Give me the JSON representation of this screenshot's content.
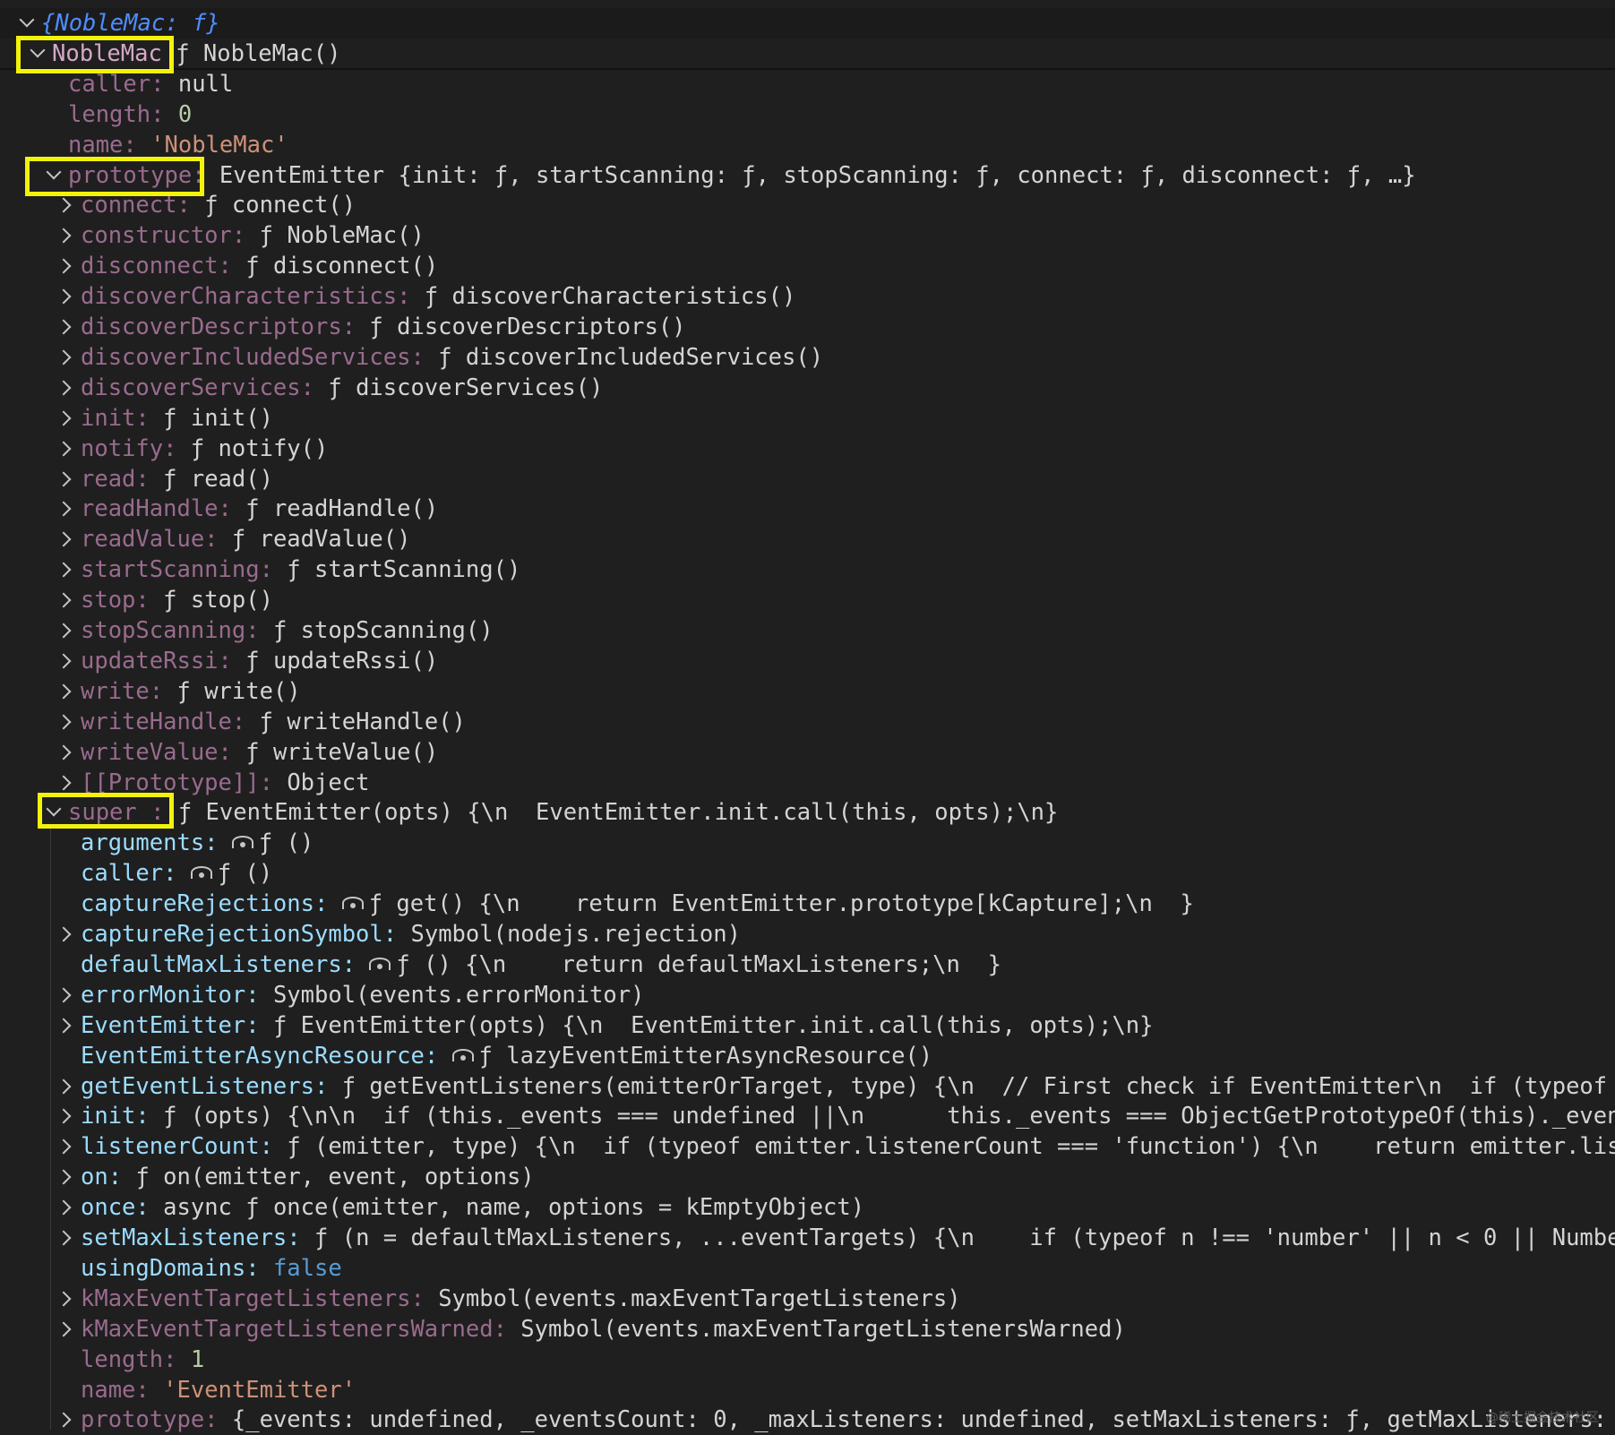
{
  "rows": [
    {
      "indent": 0,
      "twisty": "expanded",
      "key": "{NobleMac:",
      "keyClass": "root",
      "value": " f}",
      "valueClass": "root-f",
      "noColon": true
    },
    {
      "indent": 1,
      "twisty": "expanded",
      "key": "NobleMac",
      "keyClass": "plain",
      "value": "ƒ NobleMac()",
      "valueClass": "fn"
    },
    {
      "indent": 2,
      "twisty": "none",
      "key": "caller",
      "keyClass": "dim",
      "value": "null",
      "valueClass": "kw-plain"
    },
    {
      "indent": 2,
      "twisty": "none",
      "key": "length",
      "keyClass": "dim",
      "value": "0",
      "valueClass": "num"
    },
    {
      "indent": 2,
      "twisty": "none",
      "key": "name",
      "keyClass": "dim",
      "value": "'NobleMac'",
      "valueClass": "str"
    },
    {
      "indent": 2,
      "twisty": "expanded",
      "key": "prototype",
      "keyClass": "dim",
      "value": "EventEmitter {init: ƒ, startScanning: ƒ, stopScanning: ƒ, connect: ƒ, disconnect: ƒ, …}",
      "valueClass": "fn"
    },
    {
      "indent": 3,
      "twisty": "collapsed",
      "key": "connect",
      "keyClass": "dim",
      "value": "ƒ connect()",
      "valueClass": "fn"
    },
    {
      "indent": 3,
      "twisty": "collapsed",
      "key": "constructor",
      "keyClass": "dim",
      "value": "ƒ NobleMac()",
      "valueClass": "fn"
    },
    {
      "indent": 3,
      "twisty": "collapsed",
      "key": "disconnect",
      "keyClass": "dim",
      "value": "ƒ disconnect()",
      "valueClass": "fn"
    },
    {
      "indent": 3,
      "twisty": "collapsed",
      "key": "discoverCharacteristics",
      "keyClass": "dim",
      "value": "ƒ discoverCharacteristics()",
      "valueClass": "fn"
    },
    {
      "indent": 3,
      "twisty": "collapsed",
      "key": "discoverDescriptors",
      "keyClass": "dim",
      "value": "ƒ discoverDescriptors()",
      "valueClass": "fn"
    },
    {
      "indent": 3,
      "twisty": "collapsed",
      "key": "discoverIncludedServices",
      "keyClass": "dim",
      "value": "ƒ discoverIncludedServices()",
      "valueClass": "fn"
    },
    {
      "indent": 3,
      "twisty": "collapsed",
      "key": "discoverServices",
      "keyClass": "dim",
      "value": "ƒ discoverServices()",
      "valueClass": "fn"
    },
    {
      "indent": 3,
      "twisty": "collapsed",
      "key": "init",
      "keyClass": "dim",
      "value": "ƒ init()",
      "valueClass": "fn"
    },
    {
      "indent": 3,
      "twisty": "collapsed",
      "key": "notify",
      "keyClass": "dim",
      "value": "ƒ notify()",
      "valueClass": "fn"
    },
    {
      "indent": 3,
      "twisty": "collapsed",
      "key": "read",
      "keyClass": "dim",
      "value": "ƒ read()",
      "valueClass": "fn"
    },
    {
      "indent": 3,
      "twisty": "collapsed",
      "key": "readHandle",
      "keyClass": "dim",
      "value": "ƒ readHandle()",
      "valueClass": "fn"
    },
    {
      "indent": 3,
      "twisty": "collapsed",
      "key": "readValue",
      "keyClass": "dim",
      "value": "ƒ readValue()",
      "valueClass": "fn"
    },
    {
      "indent": 3,
      "twisty": "collapsed",
      "key": "startScanning",
      "keyClass": "dim",
      "value": "ƒ startScanning()",
      "valueClass": "fn"
    },
    {
      "indent": 3,
      "twisty": "collapsed",
      "key": "stop",
      "keyClass": "dim",
      "value": "ƒ stop()",
      "valueClass": "fn"
    },
    {
      "indent": 3,
      "twisty": "collapsed",
      "key": "stopScanning",
      "keyClass": "dim",
      "value": "ƒ stopScanning()",
      "valueClass": "fn"
    },
    {
      "indent": 3,
      "twisty": "collapsed",
      "key": "updateRssi",
      "keyClass": "dim",
      "value": "ƒ updateRssi()",
      "valueClass": "fn"
    },
    {
      "indent": 3,
      "twisty": "collapsed",
      "key": "write",
      "keyClass": "dim",
      "value": "ƒ write()",
      "valueClass": "fn"
    },
    {
      "indent": 3,
      "twisty": "collapsed",
      "key": "writeHandle",
      "keyClass": "dim",
      "value": "ƒ writeHandle()",
      "valueClass": "fn"
    },
    {
      "indent": 3,
      "twisty": "collapsed",
      "key": "writeValue",
      "keyClass": "dim",
      "value": "ƒ writeValue()",
      "valueClass": "fn"
    },
    {
      "indent": 3,
      "twisty": "collapsed",
      "key": "[[Prototype]]",
      "keyClass": "dim",
      "value": "Object",
      "valueClass": "fn"
    },
    {
      "indent": 2,
      "twisty": "expanded",
      "key": "super_",
      "keyClass": "dim",
      "value": "ƒ EventEmitter(opts) {\\n  EventEmitter.init.call(this, opts);\\n}",
      "valueClass": "fn"
    },
    {
      "indent": 3,
      "twisty": "none",
      "key": "arguments",
      "keyClass": "bright",
      "eye": true,
      "value": "ƒ ()",
      "valueClass": "fn"
    },
    {
      "indent": 3,
      "twisty": "none",
      "key": "caller",
      "keyClass": "bright",
      "eye": true,
      "value": "ƒ ()",
      "valueClass": "fn"
    },
    {
      "indent": 3,
      "twisty": "none",
      "key": "captureRejections",
      "keyClass": "bright",
      "eye": true,
      "value": "ƒ get() {\\n    return EventEmitter.prototype[kCapture];\\n  }",
      "valueClass": "fn"
    },
    {
      "indent": 3,
      "twisty": "collapsed",
      "key": "captureRejectionSymbol",
      "keyClass": "bright",
      "value": "Symbol(nodejs.rejection)",
      "valueClass": "fn"
    },
    {
      "indent": 3,
      "twisty": "none",
      "key": "defaultMaxListeners",
      "keyClass": "bright",
      "eye": true,
      "value": "ƒ () {\\n    return defaultMaxListeners;\\n  }",
      "valueClass": "fn"
    },
    {
      "indent": 3,
      "twisty": "collapsed",
      "key": "errorMonitor",
      "keyClass": "bright",
      "value": "Symbol(events.errorMonitor)",
      "valueClass": "fn"
    },
    {
      "indent": 3,
      "twisty": "collapsed",
      "key": "EventEmitter",
      "keyClass": "bright",
      "value": "ƒ EventEmitter(opts) {\\n  EventEmitter.init.call(this, opts);\\n}",
      "valueClass": "fn"
    },
    {
      "indent": 3,
      "twisty": "none",
      "key": "EventEmitterAsyncResource",
      "keyClass": "bright",
      "eye": true,
      "value": "ƒ lazyEventEmitterAsyncResource()",
      "valueClass": "fn"
    },
    {
      "indent": 3,
      "twisty": "collapsed",
      "key": "getEventListeners",
      "keyClass": "bright",
      "value": "ƒ getEventListeners(emitterOrTarget, type) {\\n  // First check if EventEmitter\\n  if (typeof emitter",
      "valueClass": "fn"
    },
    {
      "indent": 3,
      "twisty": "collapsed",
      "key": "init",
      "keyClass": "bright",
      "value": "ƒ (opts) {\\n\\n  if (this._events === undefined ||\\n      this._events === ObjectGetPrototypeOf(this)._events) {\\n",
      "valueClass": "fn"
    },
    {
      "indent": 3,
      "twisty": "collapsed",
      "key": "listenerCount",
      "keyClass": "bright",
      "value": "ƒ (emitter, type) {\\n  if (typeof emitter.listenerCount === 'function') {\\n    return emitter.listenerCo",
      "valueClass": "fn"
    },
    {
      "indent": 3,
      "twisty": "collapsed",
      "key": "on",
      "keyClass": "bright",
      "value": "ƒ on(emitter, event, options)",
      "valueClass": "fn"
    },
    {
      "indent": 3,
      "twisty": "collapsed",
      "key": "once",
      "keyClass": "bright",
      "value": "async ƒ once(emitter, name, options = kEmptyObject)",
      "valueClass": "fn"
    },
    {
      "indent": 3,
      "twisty": "collapsed",
      "key": "setMaxListeners",
      "keyClass": "bright",
      "value": "ƒ (n = defaultMaxListeners, ...eventTargets) {\\n    if (typeof n !== 'number' || n < 0 || NumberIsNaN(",
      "valueClass": "fn"
    },
    {
      "indent": 3,
      "twisty": "none",
      "key": "usingDomains",
      "keyClass": "bright",
      "value": "false",
      "valueClass": "kw"
    },
    {
      "indent": 3,
      "twisty": "collapsed",
      "key": "kMaxEventTargetListeners",
      "keyClass": "dim",
      "value": "Symbol(events.maxEventTargetListeners)",
      "valueClass": "fn"
    },
    {
      "indent": 3,
      "twisty": "collapsed",
      "key": "kMaxEventTargetListenersWarned",
      "keyClass": "dim",
      "value": "Symbol(events.maxEventTargetListenersWarned)",
      "valueClass": "fn"
    },
    {
      "indent": 3,
      "twisty": "none",
      "key": "length",
      "keyClass": "dim",
      "value": "1",
      "valueClass": "num"
    },
    {
      "indent": 3,
      "twisty": "none",
      "key": "name",
      "keyClass": "dim",
      "value": "'EventEmitter'",
      "valueClass": "str"
    },
    {
      "indent": 3,
      "twisty": "collapsed",
      "key": "prototype",
      "keyClass": "dim",
      "value": "{_events: undefined, _eventsCount: 0, _maxListeners: undefined, setMaxListeners: ƒ, getMaxListeners: ƒ, …}",
      "valueClass": "fn"
    }
  ],
  "highlights": [
    "NobleMac",
    "prototype",
    "super_"
  ],
  "colors": {
    "background": "#1f1f1f",
    "highlight": "#f2f20a",
    "key_bright": "#9cdcfe",
    "key_dim": "#9a6b8e",
    "string": "#ce9178",
    "number": "#b5cea8",
    "keyword": "#569cd6"
  },
  "watermark": "@稀土掘金技术社区"
}
